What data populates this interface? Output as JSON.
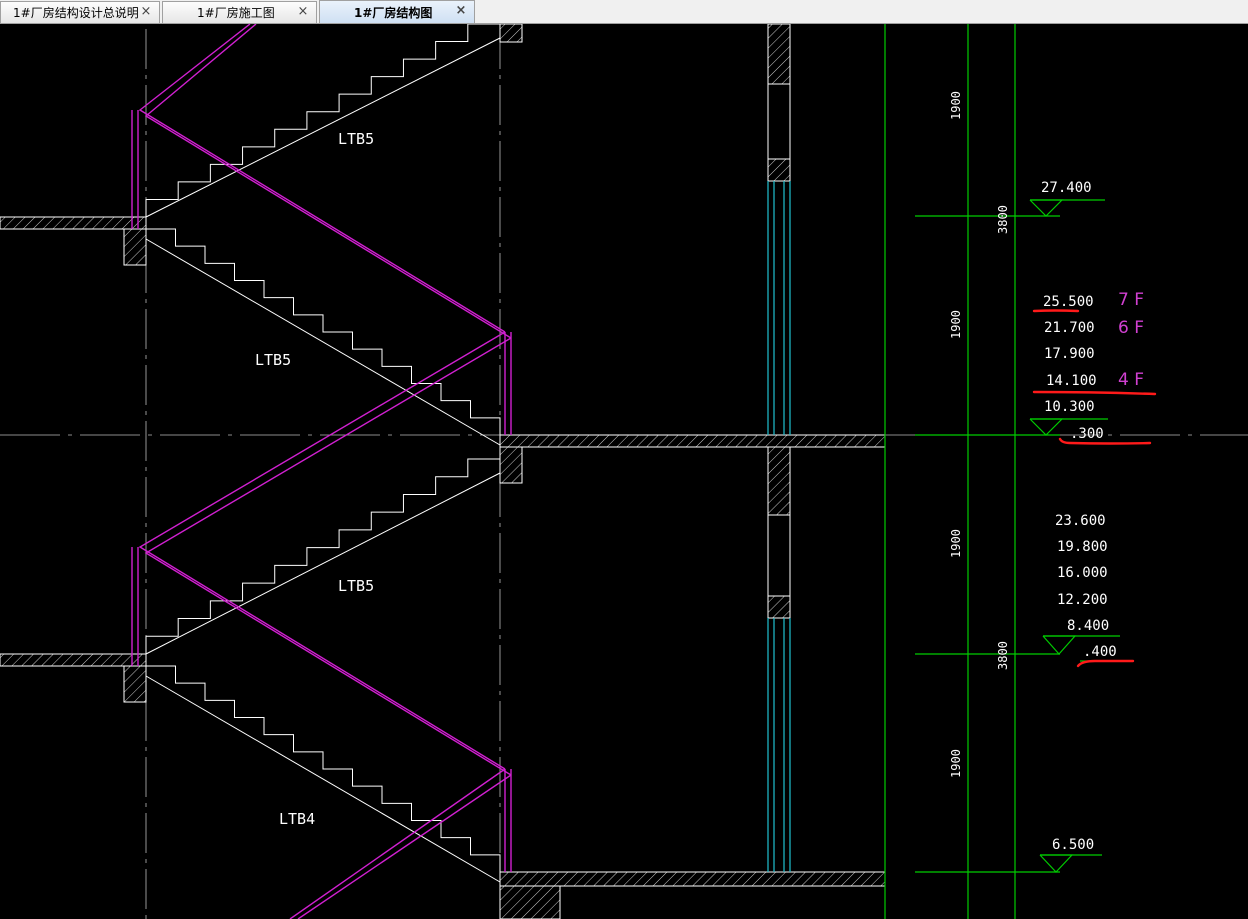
{
  "tabs": [
    {
      "label": "1#厂房结构设计总说明",
      "active": false
    },
    {
      "label": "1#厂房施工图",
      "active": false
    },
    {
      "label": "1#厂房结构图",
      "active": true
    }
  ],
  "tab_close_glyph": "×",
  "drawing": {
    "stair_labels": [
      "LTB5",
      "LTB5",
      "LTB5",
      "LTB4"
    ],
    "dimensions": [
      "1900",
      "3800",
      "1900",
      "1900",
      "3800",
      "1900"
    ],
    "elevations_upper": [
      "27.400",
      "25.500",
      "21.700",
      "17.900",
      "14.100",
      "10.300",
      ".300"
    ],
    "floor_marks": [
      "7 F",
      "6 F",
      "4 F"
    ],
    "elevations_lower": [
      "23.600",
      "19.800",
      "16.000",
      "12.200",
      "8.400",
      ".400"
    ],
    "elevation_bottom": "6.500",
    "colors": {
      "background": "#000000",
      "stair_line": "#ffffff",
      "handrail": "#d020d0",
      "axis_line": "#00cc00",
      "column": "#20c0d0",
      "markup": "#ff1a1a",
      "floor_mark": "#d040d0"
    }
  }
}
